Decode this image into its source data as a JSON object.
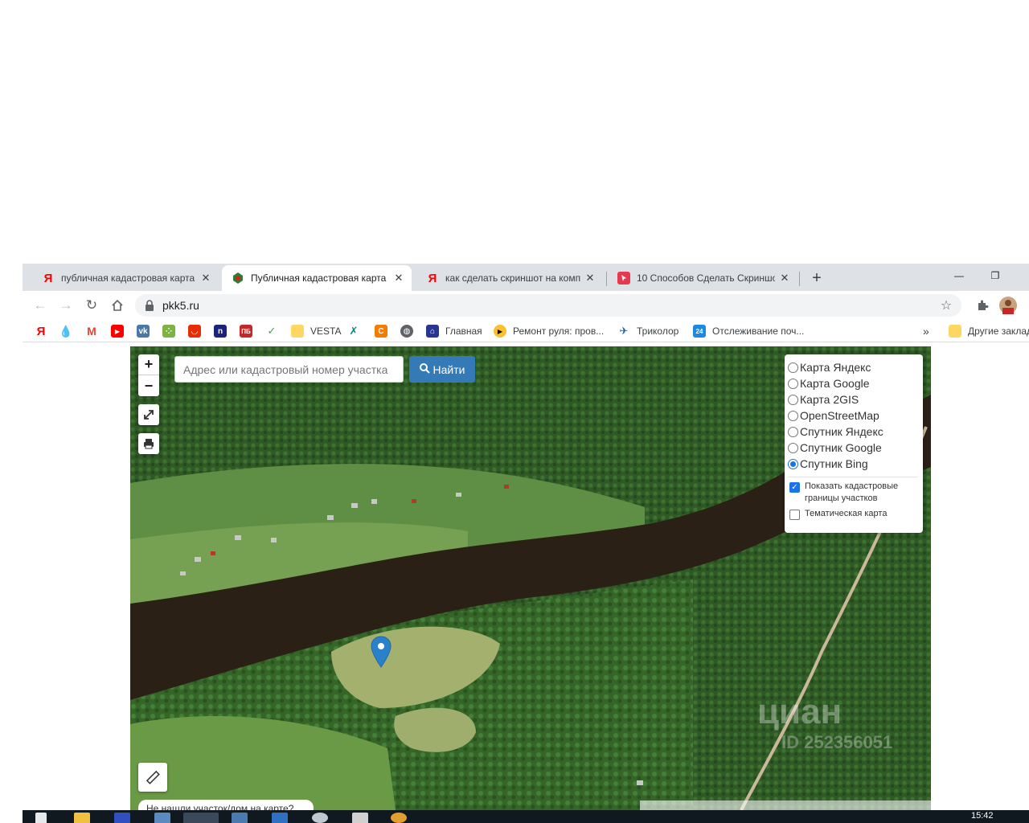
{
  "browser": {
    "tabs": [
      {
        "title": "публичная кадастровая карта —",
        "favicon": "yandex-icon"
      },
      {
        "title": "Публичная кадастровая карта Р",
        "favicon": "pkk-map-icon"
      },
      {
        "title": "как сделать скриншот на компь",
        "favicon": "yandex-icon"
      },
      {
        "title": "10 Способов Сделать Скриншо",
        "favicon": "screenshot-site-icon"
      }
    ],
    "new_tab": "+",
    "window": {
      "minimize": "—",
      "restore": "❐"
    },
    "url": "pkk5.ru"
  },
  "bookmarks": {
    "items": [
      {
        "label": "",
        "icon": "yandex-icon",
        "color": "#ff0000"
      },
      {
        "label": "",
        "icon": "drop-icon",
        "color": "#1e88e5"
      },
      {
        "label": "",
        "icon": "gmail-icon",
        "color": "#ea4335"
      },
      {
        "label": "",
        "icon": "youtube-icon",
        "color": "#ff0000"
      },
      {
        "label": "",
        "icon": "vk-icon",
        "color": "#4a76a8"
      },
      {
        "label": "",
        "icon": "apps-icon",
        "color": "#7cb342"
      },
      {
        "label": "",
        "icon": "aliexpress-icon",
        "color": "#e62e04"
      },
      {
        "label": "",
        "icon": "n-icon",
        "color": "#1a237e"
      },
      {
        "label": "",
        "icon": "pb-icon",
        "color": "#c62828"
      },
      {
        "label": "",
        "icon": "check-icon",
        "color": "#43a047"
      },
      {
        "label": "VESTA",
        "icon": "folder-icon",
        "color": "#fdd663"
      },
      {
        "label": "",
        "icon": "dna-icon",
        "color": "#00897b"
      },
      {
        "label": "",
        "icon": "c-icon",
        "color": "#f57c00"
      },
      {
        "label": "",
        "icon": "globe-icon",
        "color": "#5f6368"
      },
      {
        "label": "Главная",
        "icon": "home-site-icon",
        "color": "#283593"
      },
      {
        "label": "Ремонт руля: пров...",
        "icon": "play-icon",
        "color": "#fbc02d"
      },
      {
        "label": "Триколор",
        "icon": "tricolor-icon",
        "color": "#1565c0"
      },
      {
        "label": "Отслеживание поч...",
        "icon": "24-icon",
        "color": "#1e88e5"
      }
    ],
    "more": "»",
    "other": "Другие заклад"
  },
  "map": {
    "search_placeholder": "Адрес или кадастровый номер участка",
    "find_label": "Найти",
    "zoom_in": "+",
    "zoom_out": "−",
    "layers": [
      {
        "label": "Карта Яндекс",
        "selected": false
      },
      {
        "label": "Карта Google",
        "selected": false
      },
      {
        "label": "Карта 2GIS",
        "selected": false
      },
      {
        "label": "OpenStreetMap",
        "selected": false
      },
      {
        "label": "Спутник Яндекс",
        "selected": false
      },
      {
        "label": "Спутник Google",
        "selected": false
      },
      {
        "label": "Спутник Bing",
        "selected": true
      }
    ],
    "options": [
      {
        "label": "Показать кадастровые границы участков",
        "checked": true
      },
      {
        "label": "Тематическая карта",
        "checked": false
      }
    ],
    "watermark": "циан",
    "watermark_id": "ID 252356051",
    "not_found": "Не нашли участок/дом на карте?"
  },
  "taskbar": {
    "time": "15:42"
  },
  "colors": {
    "accent": "#337ab7",
    "marker": "#2a81cb",
    "river": "#2b2016"
  }
}
